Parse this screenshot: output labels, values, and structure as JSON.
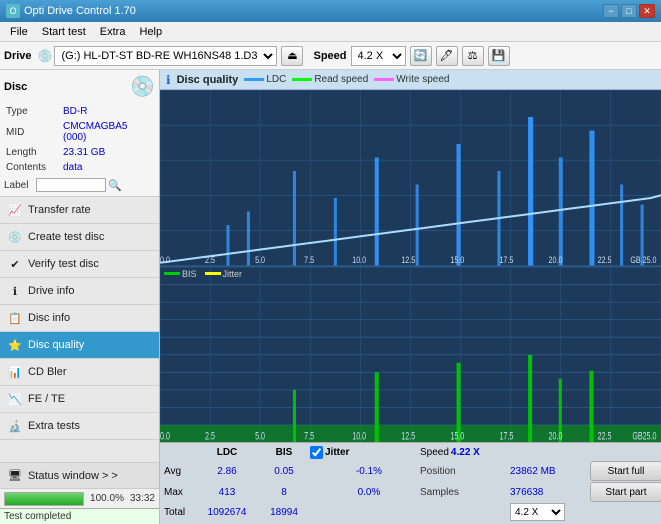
{
  "titlebar": {
    "title": "Opti Drive Control 1.70",
    "minimize": "−",
    "maximize": "□",
    "close": "✕"
  },
  "menubar": {
    "items": [
      "File",
      "Start test",
      "Extra",
      "Help"
    ]
  },
  "toolbar": {
    "drive_label": "Drive",
    "drive_value": "(G:)  HL-DT-ST BD-RE  WH16NS48 1.D3",
    "speed_label": "Speed",
    "speed_value": "4.2 X"
  },
  "disc_panel": {
    "title": "Disc",
    "type_label": "Type",
    "type_value": "BD-R",
    "mid_label": "MID",
    "mid_value": "CMCMAGBA5 (000)",
    "length_label": "Length",
    "length_value": "23.31 GB",
    "contents_label": "Contents",
    "contents_value": "data",
    "label_label": "Label"
  },
  "nav": {
    "items": [
      {
        "id": "transfer-rate",
        "label": "Transfer rate",
        "icon": "📈"
      },
      {
        "id": "create-test-disc",
        "label": "Create test disc",
        "icon": "💿"
      },
      {
        "id": "verify-test-disc",
        "label": "Verify test disc",
        "icon": "✔"
      },
      {
        "id": "drive-info",
        "label": "Drive info",
        "icon": "ℹ"
      },
      {
        "id": "disc-info",
        "label": "Disc info",
        "icon": "📋"
      },
      {
        "id": "disc-quality",
        "label": "Disc quality",
        "icon": "⭐",
        "active": true
      },
      {
        "id": "cd-bler",
        "label": "CD Bler",
        "icon": "📊"
      },
      {
        "id": "fe-te",
        "label": "FE / TE",
        "icon": "📉"
      },
      {
        "id": "extra-tests",
        "label": "Extra tests",
        "icon": "🔬"
      }
    ]
  },
  "status_window": {
    "label": "Status window > >",
    "icon": "🖥"
  },
  "progress": {
    "percent": 100,
    "fill_width": "100%",
    "percent_label": "100.0%",
    "time_label": "33:32"
  },
  "dq_header": {
    "title": "Disc quality",
    "legend_ldc": "LDC",
    "legend_read": "Read speed",
    "legend_write": "Write speed",
    "legend_bis": "BIS",
    "legend_jitter": "Jitter"
  },
  "stats": {
    "ldc_header": "LDC",
    "bis_header": "BIS",
    "jitter_header": "Jitter",
    "speed_header": "Speed",
    "position_header": "Position",
    "samples_header": "Samples",
    "avg_label": "Avg",
    "max_label": "Max",
    "total_label": "Total",
    "avg_ldc": "2.86",
    "avg_bis": "0.05",
    "avg_jitter": "-0.1%",
    "max_ldc": "413",
    "max_bis": "8",
    "max_jitter": "0.0%",
    "total_ldc": "1092674",
    "total_bis": "18994",
    "speed_val": "4.22 X",
    "position_val": "23862 MB",
    "samples_val": "376638",
    "speed_dropdown": "4.2 X",
    "btn_start_full": "Start full",
    "btn_start_part": "Start part"
  },
  "status_bar": {
    "text": "Test completed"
  }
}
